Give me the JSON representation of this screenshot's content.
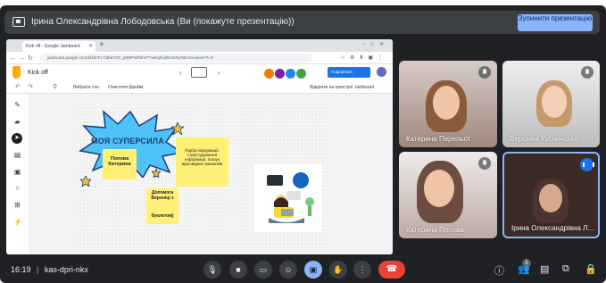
{
  "banner": {
    "text": "Ірина Олександрівна Лободовська (Ви (покажуте презентацію))",
    "stop_button": "Зупинити презентацію"
  },
  "browser": {
    "tab_title": "Kick off - Google Jamboard",
    "url": "jamboard.google.com/d/1knFL7QbkY0G_p8WFwRbhsTYwKqfsvj0DJVNyN8AG/viewer?f=0"
  },
  "jamboard": {
    "title": "Kick off",
    "share_label": "Поділитися",
    "toolbar": {
      "set_background": "Вибрати тло",
      "clear_frame": "Очистити фрейм",
      "open_on_device": "Відкрити на пристрої Jamboard"
    },
    "canvas": {
      "burst_text": "МОЯ СУПЕРСИЛА",
      "notes": [
        "Попова Катерина",
        "Підбір інформації, структурування інформації, пошук відповідних малюнків",
        "Допомога Вероніці з",
        "буклетом)"
      ]
    }
  },
  "participants": [
    {
      "name": "Катерина Перепьот"
    },
    {
      "name": "Вероніка Кусчинська"
    },
    {
      "name": "Катерина Попова"
    },
    {
      "name": "Ірина Олександрівна Л..."
    }
  ],
  "bottom_bar": {
    "time": "16:19",
    "separator": "|",
    "meeting_code": "kas-dpri-nkx",
    "people_count": "5"
  },
  "colors": {
    "meet_bg": "#202124",
    "end_call": "#ea4335",
    "accent": "#8ab4f8",
    "sticky": "#fff176"
  },
  "icons": [
    "mic-icon",
    "camera-icon",
    "captions-icon",
    "emoji-icon",
    "present-icon",
    "hand-icon",
    "more-icon",
    "end-call-icon",
    "info-icon",
    "people-icon",
    "chat-icon",
    "activities-icon",
    "host-controls-icon"
  ]
}
